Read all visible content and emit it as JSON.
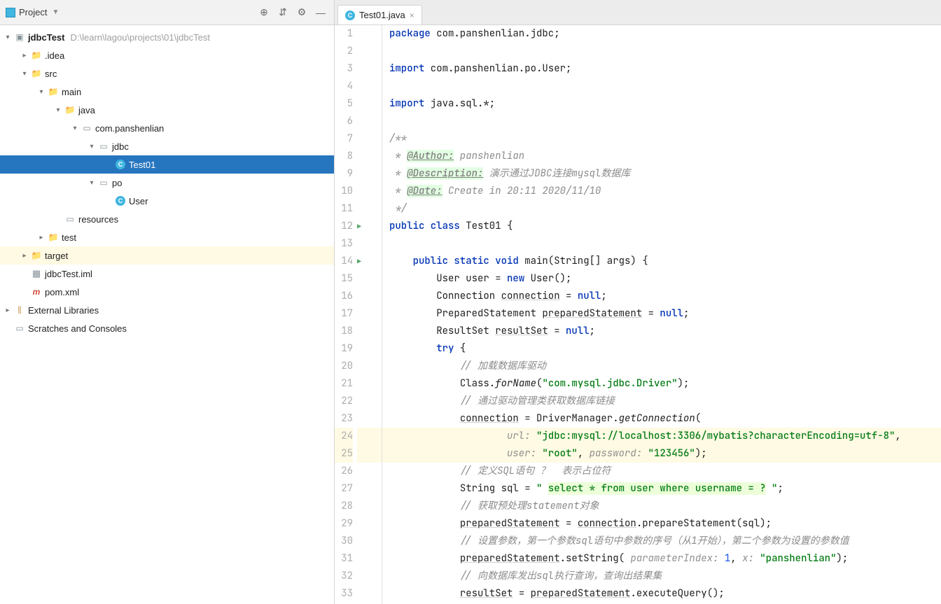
{
  "sidebar": {
    "title": "Project",
    "tree": {
      "root": {
        "name": "jdbcTest",
        "path": "D:\\learn\\lagou\\projects\\01\\jdbcTest"
      },
      "idea": ".idea",
      "src": "src",
      "main": "main",
      "java": "java",
      "pkg": "com.panshenlian",
      "jdbc": "jdbc",
      "test01": "Test01",
      "po": "po",
      "user": "User",
      "resources": "resources",
      "test": "test",
      "target": "target",
      "iml": "jdbcTest.iml",
      "pom": "pom.xml",
      "external": "External Libraries",
      "scratches": "Scratches and Consoles"
    }
  },
  "tab": {
    "label": "Test01.java"
  },
  "lines": [
    "1",
    "2",
    "3",
    "4",
    "5",
    "6",
    "7",
    "8",
    "9",
    "10",
    "11",
    "12",
    "13",
    "14",
    "15",
    "16",
    "17",
    "18",
    "19",
    "20",
    "21",
    "22",
    "23",
    "24",
    "25",
    "26",
    "27",
    "28",
    "29",
    "30",
    "31",
    "32",
    "33"
  ],
  "code": {
    "l1_kw": "package",
    "l1_rest": " com.panshenlian.jdbc;",
    "l3_kw": "import",
    "l3_rest": " com.panshenlian.po.User;",
    "l5_kw": "import",
    "l5_rest": " java.sql.*;",
    "l7": "/**",
    "l8_star": " * ",
    "l8_tag": "@Author:",
    "l8_val": " panshenlian",
    "l9_star": " * ",
    "l9_tag": "@Description:",
    "l9_val": " 演示通过JDBC连接mysql数据库",
    "l10_star": " * ",
    "l10_tag": "@Date:",
    "l10_val": " Create in 20:11 2020/11/10",
    "l11": " */",
    "l12_a": "public class",
    "l12_b": " Test01 {",
    "l14_a": "public static void",
    "l14_b": " main(String[] args) {",
    "l15_a": "User user = ",
    "l15_b": "new",
    "l15_c": " User();",
    "l16_a": "Connection ",
    "l16_b": "connection",
    "l16_c": " = ",
    "l16_d": "null",
    "l16_e": ";",
    "l17_a": "PreparedStatement ",
    "l17_b": "preparedStatement",
    "l17_c": " = ",
    "l17_d": "null",
    "l17_e": ";",
    "l18_a": "ResultSet ",
    "l18_b": "resultSet",
    "l18_c": " = ",
    "l18_d": "null",
    "l18_e": ";",
    "l19_a": "try",
    "l19_b": " {",
    "l20": "// 加载数据库驱动",
    "l21_a": "Class.",
    "l21_b": "forName",
    "l21_c": "(",
    "l21_d": "\"com.mysql.jdbc.Driver\"",
    "l21_e": ");",
    "l22": "// 通过驱动管理类获取数据库链接",
    "l23_a": "connection",
    "l23_b": " = DriverManager.",
    "l23_c": "getConnection",
    "l23_d": "(",
    "l24_h": "url: ",
    "l24_s": "\"jdbc:mysql://localhost:3306/mybatis?characterEncoding=utf-8\"",
    "l24_e": ",",
    "l25_h1": "user: ",
    "l25_s1": "\"root\"",
    "l25_m": ", ",
    "l25_h2": "password: ",
    "l25_s2": "\"123456\"",
    "l25_e": ");",
    "l26": "// 定义SQL语句 ？  表示占位符",
    "l27_a": "String sql = ",
    "l27_b": "\" ",
    "l27_c": "select * from user where username = ?",
    "l27_d": " \"",
    "l27_e": ";",
    "l28": "// 获取预处理statement对象",
    "l29_a": "preparedStatement",
    "l29_b": " = ",
    "l29_c": "connection",
    "l29_d": ".prepareStatement(sql);",
    "l30": "// 设置参数，第一个参数sql语句中参数的序号（从1开始），第二个参数为设置的参数值",
    "l31_a": "preparedStatement",
    "l31_b": ".setString( ",
    "l31_h1": "parameterIndex: ",
    "l31_n": "1",
    "l31_m": ", ",
    "l31_h2": "x: ",
    "l31_s": "\"panshenlian\"",
    "l31_e": ");",
    "l32": "// 向数据库发出sql执行查询，查询出结果集",
    "l33_a": "resultSet",
    "l33_b": " = ",
    "l33_c": "preparedStatement",
    "l33_d": ".executeQuery();"
  }
}
